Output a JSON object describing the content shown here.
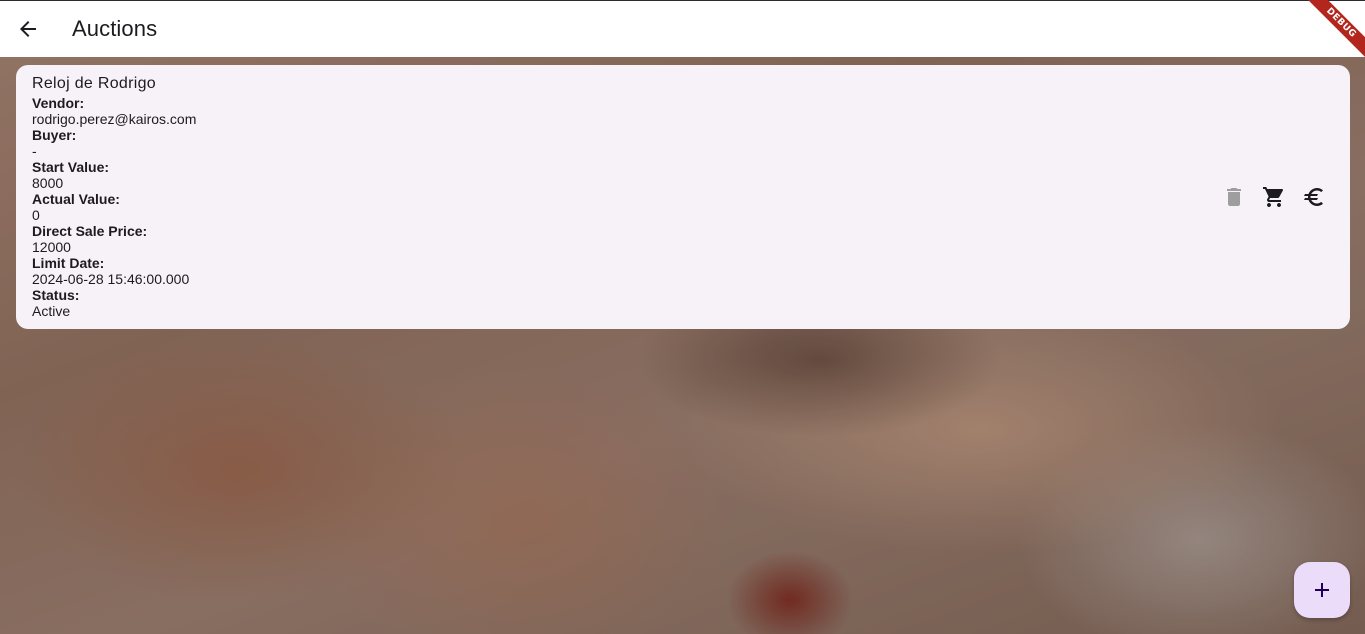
{
  "app": {
    "title": "Auctions",
    "debug_label": "DEBUG"
  },
  "auction": {
    "name": "Reloj de Rodrigo",
    "fields": [
      {
        "label": "Vendor:",
        "value": "rodrigo.perez@kairos.com"
      },
      {
        "label": "Buyer:",
        "value": "-"
      },
      {
        "label": "Start Value:",
        "value": "8000"
      },
      {
        "label": "Actual Value:",
        "value": "0"
      },
      {
        "label": "Direct Sale Price:",
        "value": "12000"
      },
      {
        "label": "Limit Date:",
        "value": "2024-06-28 15:46:00.000"
      },
      {
        "label": "Status:",
        "value": "Active"
      }
    ],
    "actions": [
      {
        "icon": "delete-icon",
        "enabled": false
      },
      {
        "icon": "shopping-cart-icon",
        "enabled": true
      },
      {
        "icon": "euro-icon",
        "enabled": true
      }
    ]
  },
  "fab": {
    "icon": "add-icon"
  },
  "colors": {
    "appbar_bg": "#ffffff",
    "card_bg": "#f6f2f8",
    "fab_bg": "#ebdcfa",
    "debug_ribbon": "#b3261e",
    "text": "#1d1b20",
    "disabled_icon": "#9e9e9e"
  }
}
